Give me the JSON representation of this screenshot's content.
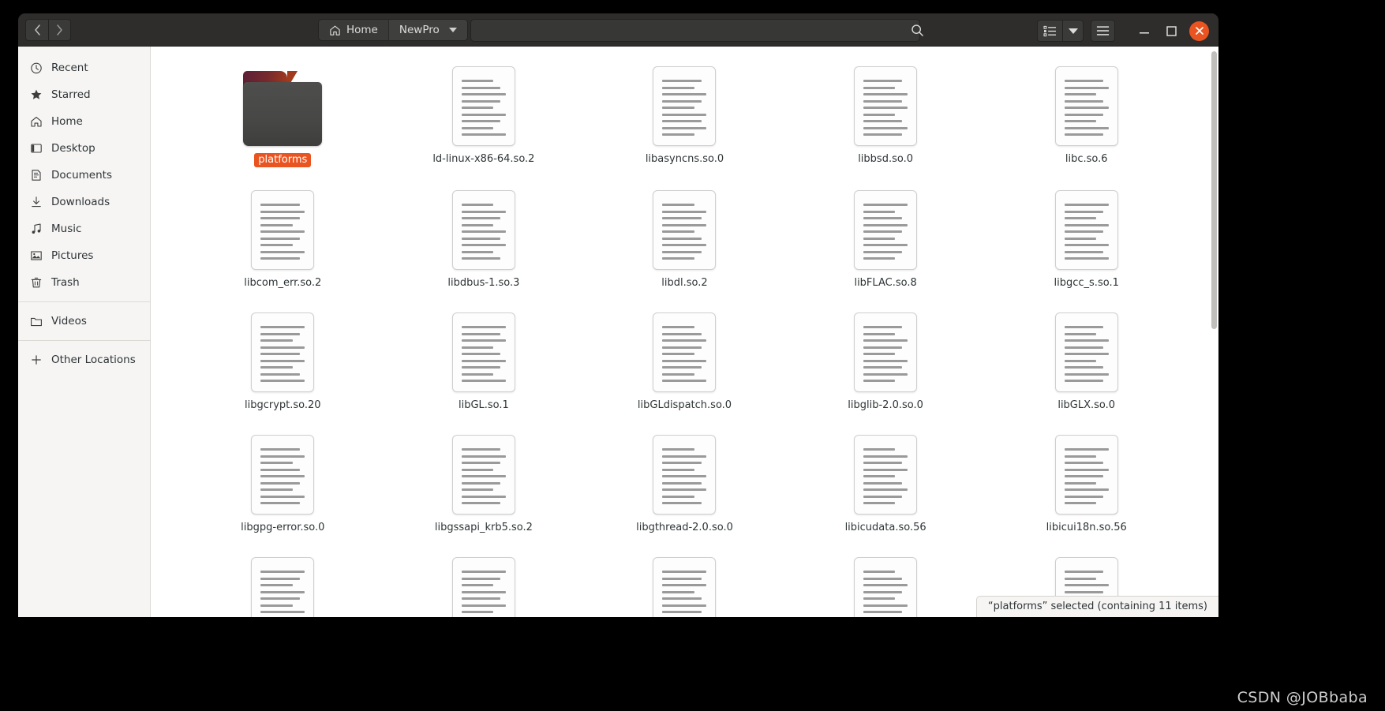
{
  "window": {
    "nav": {
      "back_label": "‹",
      "forward_label": "›"
    }
  },
  "header": {
    "breadcrumbs": [
      {
        "label": "Home",
        "icon": "home-icon",
        "current": false
      },
      {
        "label": "NewPro",
        "icon": "",
        "current": true
      }
    ],
    "location_value": "",
    "location_placeholder": "",
    "search_icon": "search-icon",
    "view_list_icon": "list-view-icon",
    "view_dropdown_icon": "chevron-down-icon",
    "menu_icon": "hamburger-menu-icon",
    "minimize_icon": "minimize-icon",
    "maximize_icon": "maximize-icon",
    "close_icon": "close-icon"
  },
  "sidebar": {
    "items": [
      {
        "label": "Recent",
        "icon": "clock-icon"
      },
      {
        "label": "Starred",
        "icon": "star-icon"
      },
      {
        "label": "Home",
        "icon": "home-icon"
      },
      {
        "label": "Desktop",
        "icon": "desktop-icon"
      },
      {
        "label": "Documents",
        "icon": "document-icon"
      },
      {
        "label": "Downloads",
        "icon": "download-icon"
      },
      {
        "label": "Music",
        "icon": "music-note-icon"
      },
      {
        "label": "Pictures",
        "icon": "picture-icon"
      },
      {
        "label": "Trash",
        "icon": "trash-icon"
      }
    ],
    "videos": {
      "label": "Videos",
      "icon": "folder-icon"
    },
    "other_locations": {
      "label": "Other Locations",
      "icon": "plus-icon"
    }
  },
  "files": [
    {
      "name": "platforms",
      "type": "folder",
      "selected": true
    },
    {
      "name": "ld-linux-x86-64.so.2",
      "type": "document",
      "selected": false
    },
    {
      "name": "libasyncns.so.0",
      "type": "document",
      "selected": false
    },
    {
      "name": "libbsd.so.0",
      "type": "document",
      "selected": false
    },
    {
      "name": "libc.so.6",
      "type": "document",
      "selected": false
    },
    {
      "name": "libcom_err.so.2",
      "type": "document",
      "selected": false
    },
    {
      "name": "libdbus-1.so.3",
      "type": "document",
      "selected": false
    },
    {
      "name": "libdl.so.2",
      "type": "document",
      "selected": false
    },
    {
      "name": "libFLAC.so.8",
      "type": "document",
      "selected": false
    },
    {
      "name": "libgcc_s.so.1",
      "type": "document",
      "selected": false
    },
    {
      "name": "libgcrypt.so.20",
      "type": "document",
      "selected": false
    },
    {
      "name": "libGL.so.1",
      "type": "document",
      "selected": false
    },
    {
      "name": "libGLdispatch.so.0",
      "type": "document",
      "selected": false
    },
    {
      "name": "libglib-2.0.so.0",
      "type": "document",
      "selected": false
    },
    {
      "name": "libGLX.so.0",
      "type": "document",
      "selected": false
    },
    {
      "name": "libgpg-error.so.0",
      "type": "document",
      "selected": false
    },
    {
      "name": "libgssapi_krb5.so.2",
      "type": "document",
      "selected": false
    },
    {
      "name": "libgthread-2.0.so.0",
      "type": "document",
      "selected": false
    },
    {
      "name": "libicudata.so.56",
      "type": "document",
      "selected": false
    },
    {
      "name": "libicui18n.so.56",
      "type": "document",
      "selected": false
    },
    {
      "name": "",
      "type": "document",
      "selected": false
    },
    {
      "name": "",
      "type": "document",
      "selected": false
    },
    {
      "name": "",
      "type": "document",
      "selected": false
    },
    {
      "name": "",
      "type": "document",
      "selected": false
    },
    {
      "name": "",
      "type": "document",
      "selected": false
    }
  ],
  "status": {
    "text": "“platforms” selected  (containing 11 items)"
  },
  "watermark": {
    "text": "CSDN @JOBbaba"
  },
  "colors": {
    "accent": "#e95420",
    "headerbar": "#2e2d2b",
    "sidebar": "#f6f5f4",
    "canvas": "#ffffff"
  }
}
